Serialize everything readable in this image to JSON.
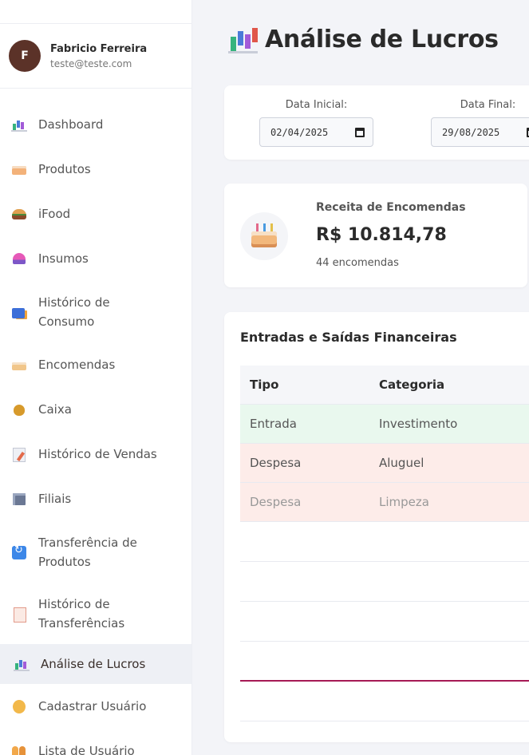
{
  "user": {
    "initial": "F",
    "name": "Fabricio Ferreira",
    "email": "teste@teste.com"
  },
  "nav": [
    {
      "label": "Dashboard",
      "icon": "chart-icon"
    },
    {
      "label": "Produtos",
      "icon": "cake-slice-icon"
    },
    {
      "label": "iFood",
      "icon": "burger-icon"
    },
    {
      "label": "Insumos",
      "icon": "cupcake-icon"
    },
    {
      "label": "Histórico de Consumo",
      "icon": "shopping-bags-icon"
    },
    {
      "label": "Encomendas",
      "icon": "birthday-cake-icon"
    },
    {
      "label": "Caixa",
      "icon": "money-bag-icon"
    },
    {
      "label": "Histórico de Vendas",
      "icon": "memo-icon"
    },
    {
      "label": "Filiais",
      "icon": "building-icon"
    },
    {
      "label": "Transferência de Produtos",
      "icon": "arrows-icon"
    },
    {
      "label": "Histórico de Transferências",
      "icon": "ledger-icon"
    },
    {
      "label": "Análise de Lucros",
      "icon": "chart-icon",
      "active": true
    },
    {
      "label": "Cadastrar Usuário",
      "icon": "face-icon"
    },
    {
      "label": "Lista de Usuário",
      "icon": "people-icon"
    }
  ],
  "page": {
    "title": "Análise de Lucros",
    "title_icon": "bar-chart-icon"
  },
  "filters": {
    "start_label": "Data Inicial:",
    "start_value": "02/04/2025",
    "end_label": "Data Final:",
    "end_value": "29/08/2025"
  },
  "revenue": {
    "label": "Receita de Encomendas",
    "value": "R$ 10.814,78",
    "count": "44 encomendas",
    "icon": "birthday-cake-icon"
  },
  "ledger": {
    "title": "Entradas e Saídas Financeiras",
    "columns": [
      "Tipo",
      "Categoria"
    ],
    "rows": [
      [
        "Entrada",
        "Investimento"
      ],
      [
        "Despesa",
        "Aluguel"
      ],
      [
        "Despesa",
        "Limpeza"
      ]
    ]
  },
  "colors": {
    "avatar": "#5b3228",
    "accent": "#a61a55",
    "entrada_bg": "#e9f8ee",
    "despesa_bg": "#fdece9"
  }
}
